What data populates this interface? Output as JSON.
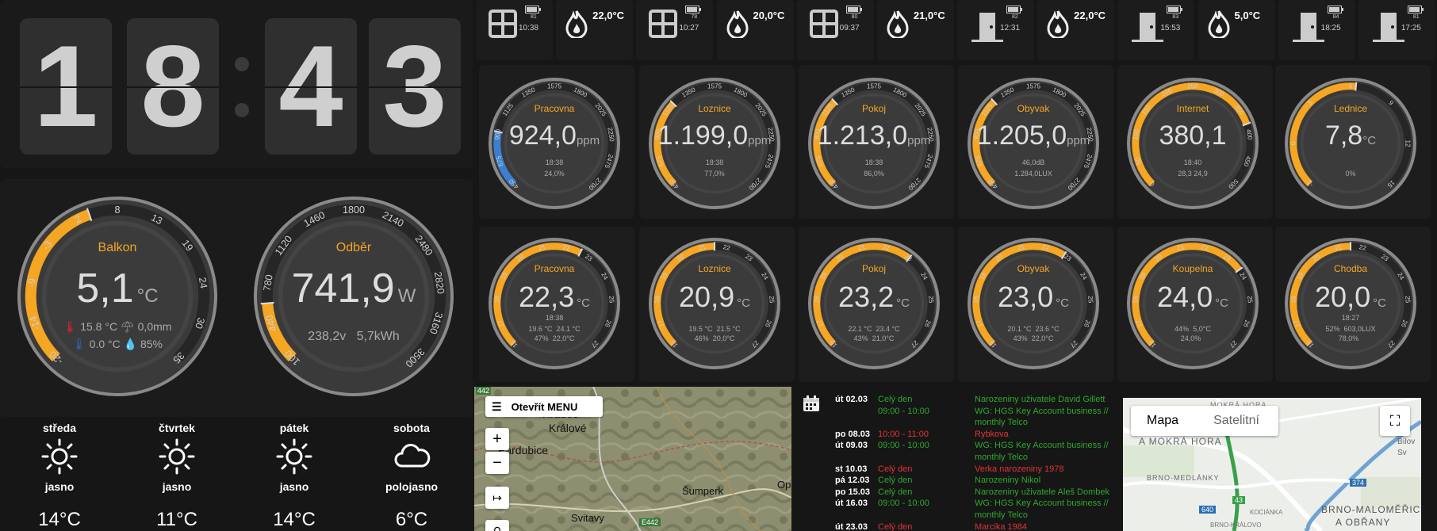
{
  "clock": {
    "d1": "1",
    "d2": "8",
    "d3": "4",
    "d4": "3"
  },
  "status": [
    {
      "icon": "window-icon",
      "badge": "81",
      "time": "10:38"
    },
    {
      "icon": "flame-icon",
      "temp": "22,0°C"
    },
    {
      "icon": "window-icon",
      "badge": "78",
      "time": "10:27"
    },
    {
      "icon": "flame-icon",
      "temp": "20,0°C"
    },
    {
      "icon": "window-icon",
      "badge": "80",
      "time": "09:37"
    },
    {
      "icon": "flame-icon",
      "temp": "21,0°C"
    },
    {
      "icon": "door-icon",
      "badge": "82",
      "time": "12:31"
    },
    {
      "icon": "flame-icon",
      "temp": "22,0°C"
    },
    {
      "icon": "door-icon",
      "badge": "83",
      "time": "15:53"
    },
    {
      "icon": "flame-icon",
      "temp": "5,0°C"
    },
    {
      "icon": "door-icon",
      "badge": "84",
      "time": "18:25"
    },
    {
      "icon": "door-icon",
      "badge": "81",
      "time": "17:25"
    }
  ],
  "big_gauges": [
    {
      "title": "Balkon",
      "value": "5,1",
      "unit": "°C",
      "ticks": [
        "-20",
        "-14",
        "-9",
        "-3",
        "2",
        "8",
        "13",
        "19",
        "24",
        "30",
        "35"
      ],
      "fill": 0.43,
      "line1": "15.8 °C",
      "line1b": "0,0mm",
      "line2": "0.0 °C",
      "line2b": "85%"
    },
    {
      "title": "Odběr",
      "value": "741,9",
      "unit": "W",
      "ticks": [
        "100",
        "440",
        "780",
        "1120",
        "1460",
        "1800",
        "2140",
        "2480",
        "2820",
        "3160",
        "3500"
      ],
      "fill": 0.15,
      "line1": "238,2v",
      "line1b": "5,7kWh"
    }
  ],
  "co2_gauges": [
    {
      "title": "Pracovna",
      "value": "924,0",
      "unit": "ppm",
      "time": "18:38",
      "extra": "24,0%",
      "fill": 0.21,
      "color": "#3a7fd0"
    },
    {
      "title": "Loznice",
      "value": "1.199,0",
      "unit": "ppm",
      "time": "18:38",
      "extra": "77,0%",
      "fill": 0.33,
      "color": "#f5a623"
    },
    {
      "title": "Pokoj",
      "value": "1.213,0",
      "unit": "ppm",
      "time": "18:38",
      "extra": "86,0%",
      "fill": 0.34,
      "color": "#f5a623"
    },
    {
      "title": "Obyvak",
      "value": "1.205,0",
      "unit": "ppm",
      "time": "46,0dB",
      "extra": "1.284,0LUX",
      "fill": 0.34,
      "color": "#f5a623"
    },
    {
      "title": "Internet",
      "value": "380,1",
      "unit": "",
      "time": "18:40",
      "extra": "28,3   24,9",
      "fill": 0.76,
      "color": "#f5a623"
    },
    {
      "title": "Lednice",
      "value": "7,8",
      "unit": "°C",
      "time": "",
      "extra": "0%",
      "fill": 0.52,
      "color": "#f5a623"
    }
  ],
  "co2_ticks": [
    "450",
    "675",
    "900",
    "1125",
    "1350",
    "1575",
    "1800",
    "2025",
    "2250",
    "2475",
    "2700"
  ],
  "internet_ticks": [
    "0",
    "50",
    "100",
    "150",
    "200",
    "250",
    "300",
    "350",
    "400",
    "450",
    "500"
  ],
  "lednice_ticks": [
    "-3",
    "0",
    "3",
    "6",
    "9",
    "12",
    "15"
  ],
  "temp_gauges": [
    {
      "title": "Pracovna",
      "value": "22,3",
      "unit": "°C",
      "time": "18:38",
      "a": "19.6 °C",
      "b": "24.1 °C",
      "c": "47%",
      "d": "22,0°C",
      "fill": 0.6
    },
    {
      "title": "Loznice",
      "value": "20,9",
      "unit": "°C",
      "time": "",
      "a": "19.5 °C",
      "b": "21.5 °C",
      "c": "46%",
      "d": "20,0°C",
      "fill": 0.5
    },
    {
      "title": "Pokoj",
      "value": "23,2",
      "unit": "°C",
      "time": "",
      "a": "22.1 °C",
      "b": "23.4 °C",
      "c": "43%",
      "d": "21,0°C",
      "fill": 0.64
    },
    {
      "title": "Obyvak",
      "value": "23,0",
      "unit": "°C",
      "time": "",
      "a": "20.1 °C",
      "b": "23.6 °C",
      "c": "43%",
      "d": "22,0°C",
      "fill": 0.62
    },
    {
      "title": "Koupelna",
      "value": "24,0",
      "unit": "°C",
      "time": "",
      "a": "44%",
      "b": "5,0°C",
      "c": "24,0%",
      "d": "",
      "fill": 0.7
    },
    {
      "title": "Chodba",
      "value": "20,0",
      "unit": "°C",
      "time": "18:27",
      "a": "52%",
      "b": "603,0LUX",
      "c": "78,0%",
      "d": "",
      "fill": 0.5
    }
  ],
  "temp_ticks": [
    "16",
    "17",
    "18",
    "19",
    "20",
    "21",
    "22",
    "23",
    "24",
    "25",
    "26",
    "27"
  ],
  "weather": [
    {
      "day": "středa",
      "cond": "jasno",
      "temp": "14°C",
      "icon": "sun-icon"
    },
    {
      "day": "čtvrtek",
      "cond": "jasno",
      "temp": "11°C",
      "icon": "sun-icon"
    },
    {
      "day": "pátek",
      "cond": "jasno",
      "temp": "14°C",
      "icon": "sun-icon"
    },
    {
      "day": "sobota",
      "cond": "polojasno",
      "temp": "6°C",
      "icon": "cloud-icon"
    }
  ],
  "map1": {
    "menu": "Otevřít MENU",
    "zoom_in": "+",
    "zoom_out": "−",
    "labels": [
      "Hradec",
      "Králové",
      "Pardubice",
      "Šumperk",
      "Svitavy",
      "Op",
      "E442",
      "442"
    ]
  },
  "calendar": [
    {
      "date": "út 02.03",
      "time": "Celý den",
      "tc": "green",
      "ev": "Narozeniny uživatele David Gillett",
      "ec": "green"
    },
    {
      "date": "",
      "time": "09:00 - 10:00",
      "tc": "green",
      "ev": "WG: HGS Key Account business //",
      "ec": "green"
    },
    {
      "date": "",
      "time": "",
      "tc": "green",
      "ev": "monthly Telco",
      "ec": "green"
    },
    {
      "date": "po 08.03",
      "time": "10:00 - 11:00",
      "tc": "red",
      "ev": "Rybkova",
      "ec": "red"
    },
    {
      "date": "út 09.03",
      "time": "09:00 - 10:00",
      "tc": "green",
      "ev": "WG: HGS Key Account business //",
      "ec": "green"
    },
    {
      "date": "",
      "time": "",
      "tc": "green",
      "ev": "monthly Telco",
      "ec": "green"
    },
    {
      "date": "st 10.03",
      "time": "Celý den",
      "tc": "red",
      "ev": "Verka narozeniny 1978",
      "ec": "red"
    },
    {
      "date": "pá 12.03",
      "time": "Celý den",
      "tc": "green",
      "ev": "Narozeniny Nikol",
      "ec": "green"
    },
    {
      "date": "po 15.03",
      "time": "Celý den",
      "tc": "green",
      "ev": "Narozeniny uživatele Aleš Dombek",
      "ec": "green"
    },
    {
      "date": "út 16.03",
      "time": "09:00 - 10:00",
      "tc": "green",
      "ev": "WG: HGS Key Account business //",
      "ec": "green"
    },
    {
      "date": "",
      "time": "",
      "tc": "green",
      "ev": "monthly Telco",
      "ec": "green"
    },
    {
      "date": "út 23.03",
      "time": "Celý den",
      "tc": "red",
      "ev": "Marcika 1984",
      "ec": "red"
    }
  ],
  "map2": {
    "tab_map": "Mapa",
    "tab_sat": "Satelitní",
    "labels": [
      "MOKRÁ HORA",
      "A MOKRÁ HORA",
      "BRNO-MEDLÁNKY",
      "BRNO-MALOMĚŘIC",
      "A OBŘANY",
      "KOCIÁNKA",
      "BRNO-KRÁLOVO",
      "Bílov",
      "Sv"
    ],
    "roads": [
      "43",
      "374",
      "640"
    ]
  }
}
